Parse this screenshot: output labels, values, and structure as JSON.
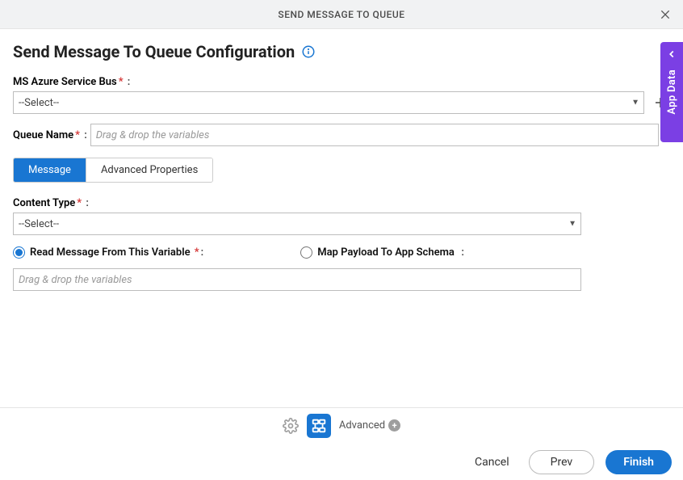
{
  "dialog": {
    "title": "SEND MESSAGE TO QUEUE"
  },
  "page": {
    "title": "Send Message To Queue Configuration"
  },
  "fields": {
    "azure_bus": {
      "label": "MS Azure Service Bus",
      "selected": "--Select--"
    },
    "queue_name": {
      "label": "Queue Name",
      "placeholder": "Drag & drop the variables"
    },
    "content_type": {
      "label": "Content Type",
      "selected": "--Select--"
    },
    "read_var": {
      "label": "Read Message From This Variable",
      "placeholder": "Drag & drop the variables"
    },
    "map_schema": {
      "label": "Map Payload To App Schema"
    }
  },
  "tabs": {
    "message": "Message",
    "advanced_props": "Advanced Properties"
  },
  "side_tab": {
    "label": "App Data"
  },
  "footer": {
    "advanced_label": "Advanced",
    "cancel": "Cancel",
    "prev": "Prev",
    "finish": "Finish"
  }
}
